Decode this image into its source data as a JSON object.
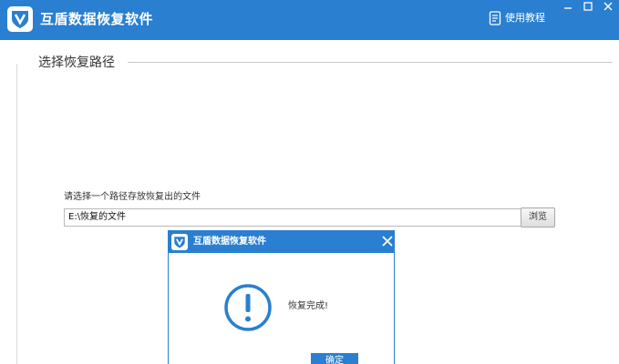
{
  "window": {
    "title": "互盾数据恢复软件",
    "help_label": "使用教程"
  },
  "section": {
    "title": "选择恢复路径"
  },
  "form": {
    "prompt": "请选择一个路径存放恢复出的文件",
    "path_value": "E:\\恢复的文件",
    "browse_label": "浏览"
  },
  "dialog": {
    "title": "互盾数据恢复软件",
    "message": "恢复完成!",
    "ok_label": "确定"
  },
  "colors": {
    "brand_blue": "#2a7fd0"
  },
  "icons": [
    "shield-logo-icon",
    "help-doc-icon",
    "minimize-icon",
    "maximize-icon",
    "close-icon",
    "alert-exclamation-icon"
  ]
}
